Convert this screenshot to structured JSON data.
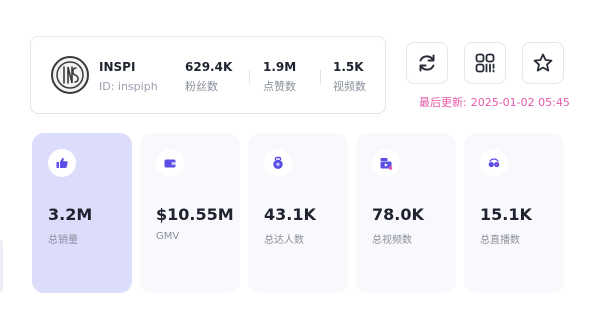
{
  "profile": {
    "name": "INSPI",
    "id_text": "ID: inspiph",
    "stats": [
      {
        "value": "629.4K",
        "label": "粉丝数"
      },
      {
        "value": "1.9M",
        "label": "点赞数"
      },
      {
        "value": "1.5K",
        "label": "视频数"
      }
    ]
  },
  "actions": {
    "refresh_icon": "refresh-icon",
    "qr_icon": "qr-code-icon",
    "favorite_icon": "star-icon"
  },
  "last_update": {
    "label": "最后更新:",
    "time": "2025-01-02 05:45"
  },
  "metrics": [
    {
      "value": "3.2M",
      "label": "总销量",
      "icon": "thumbs-up-icon"
    },
    {
      "value": "$10.55M",
      "label": "GMV",
      "icon": "wallet-icon"
    },
    {
      "value": "43.1K",
      "label": "总达人数",
      "icon": "creator-icon"
    },
    {
      "value": "78.0K",
      "label": "总视频数",
      "icon": "video-icon"
    },
    {
      "value": "15.1K",
      "label": "总直播数",
      "icon": "live-icon"
    }
  ],
  "colors": {
    "accent": "#5b4ee6",
    "active_card": "#dcdcfb",
    "update_text": "#e35aa8"
  }
}
